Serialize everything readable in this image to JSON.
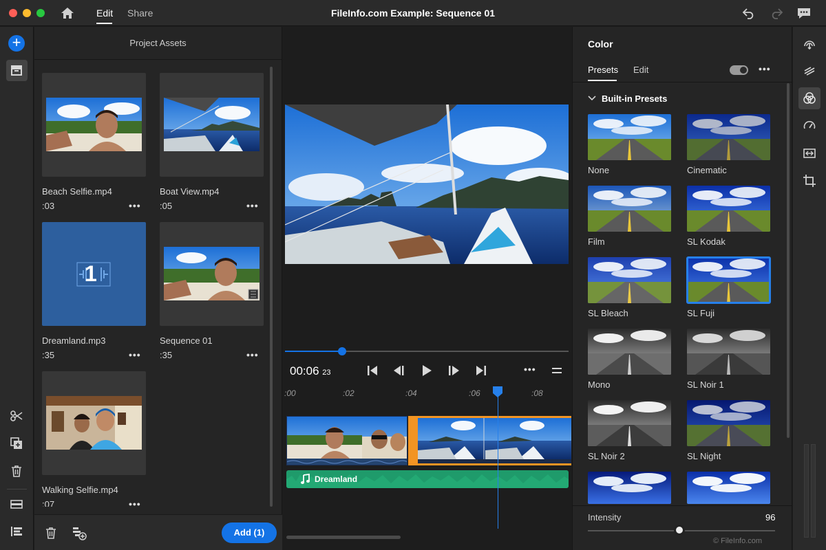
{
  "window": {
    "title": "FileInfo.com Example: Sequence 01",
    "tabs": [
      {
        "label": "Edit",
        "active": true
      },
      {
        "label": "Share",
        "active": false
      }
    ]
  },
  "left_rail": {
    "icons": [
      "add-media-icon",
      "project-assets-icon",
      "scissors-icon",
      "duplicate-icon",
      "trash-icon",
      "titles-icon",
      "timeline-tracks-icon"
    ]
  },
  "assets": {
    "title": "Project Assets",
    "items": [
      {
        "name": "Beach Selfie.mp4",
        "duration": ":03",
        "more": "•••"
      },
      {
        "name": "Boat View.mp4",
        "duration": ":05",
        "more": "•••"
      },
      {
        "name": "Dreamland.mp3",
        "duration": ":35",
        "more": "•••",
        "badge": "1"
      },
      {
        "name": "Sequence 01",
        "duration": ":35",
        "more": "•••"
      },
      {
        "name": "Walking Selfie.mp4",
        "duration": ":07",
        "more": "•••"
      }
    ],
    "add_button": "Add (1)"
  },
  "player": {
    "timecode": "00:06",
    "frames": "23",
    "progress": 0.2,
    "ruler": [
      ":00",
      ":02",
      ":04",
      ":06",
      ":08"
    ],
    "audio_clip": "Dreamland",
    "more": "•••"
  },
  "color": {
    "title": "Color",
    "tabs": [
      {
        "label": "Presets",
        "active": true
      },
      {
        "label": "Edit",
        "active": false
      }
    ],
    "more": "•••",
    "section": "Built-in Presets",
    "presets": [
      "None",
      "Cinematic",
      "Film",
      "SL Kodak",
      "SL Bleach",
      "SL Fuji",
      "Mono",
      "SL Noir 1",
      "SL Noir 2",
      "SL Night",
      "",
      ""
    ],
    "selected_preset": "SL Fuji",
    "intensity_label": "Intensity",
    "intensity": "96",
    "intensity_fraction": 0.96,
    "watermark": "© FileInfo.com"
  },
  "colors": {
    "accent": "#1473e6",
    "audio": "#1f9b6b",
    "clip_border": "#f29423"
  }
}
